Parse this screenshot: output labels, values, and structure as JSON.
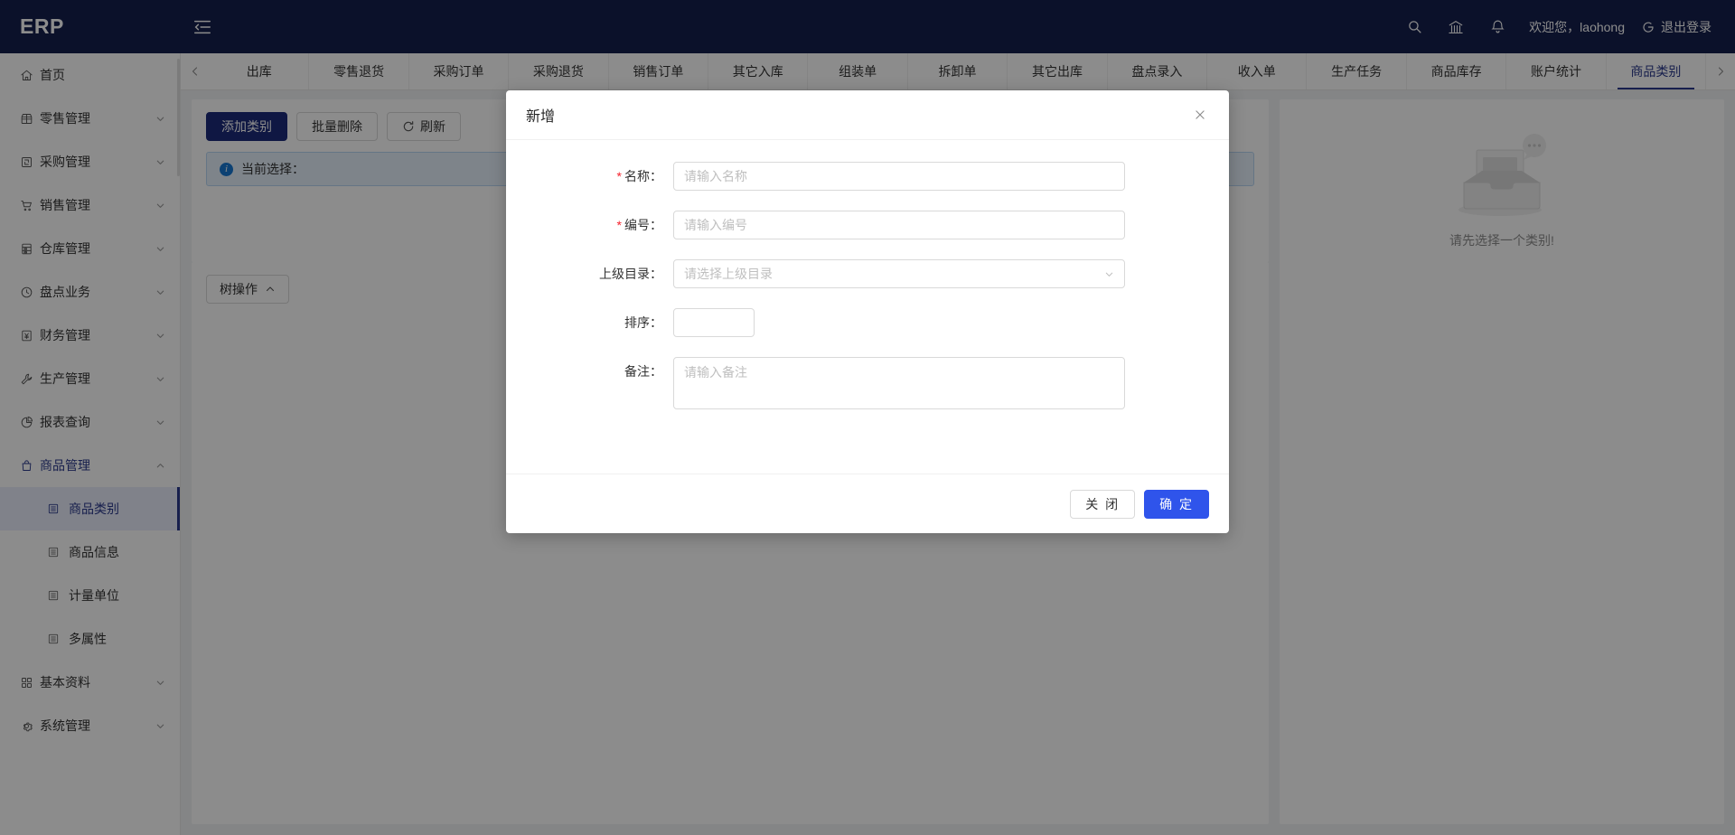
{
  "header": {
    "logo": "ERP",
    "collapse_icon": "menu-fold-icon",
    "search_icon": "search-icon",
    "bank_icon": "bank-icon",
    "bell_icon": "bell-icon",
    "welcome": "欢迎您，laohong",
    "logout_label": "退出登录",
    "logout_icon": "logout-icon",
    "bg_color": "#141f4d"
  },
  "sidebar": {
    "items": [
      {
        "label": "首页",
        "icon": "home-icon",
        "arrow": "",
        "open": false
      },
      {
        "label": "零售管理",
        "icon": "shop-icon",
        "arrow": "▾",
        "open": false
      },
      {
        "label": "采购管理",
        "icon": "sync-icon",
        "arrow": "▾",
        "open": false
      },
      {
        "label": "销售管理",
        "icon": "cart-icon",
        "arrow": "▾",
        "open": false
      },
      {
        "label": "仓库管理",
        "icon": "database-icon",
        "arrow": "▾",
        "open": false
      },
      {
        "label": "盘点业务",
        "icon": "clock-icon",
        "arrow": "▾",
        "open": false
      },
      {
        "label": "财务管理",
        "icon": "money-icon",
        "arrow": "▾",
        "open": false
      },
      {
        "label": "生产管理",
        "icon": "tool-icon",
        "arrow": "▾",
        "open": false
      },
      {
        "label": "报表查询",
        "icon": "pie-chart-icon",
        "arrow": "▾",
        "open": false
      },
      {
        "label": "商品管理",
        "icon": "bag-icon",
        "arrow": "▴",
        "open": true
      }
    ],
    "submenu": [
      {
        "label": "商品类别",
        "icon": "list-icon",
        "active": true
      },
      {
        "label": "商品信息",
        "icon": "list-icon",
        "active": false
      },
      {
        "label": "计量单位",
        "icon": "list-icon",
        "active": false
      },
      {
        "label": "多属性",
        "icon": "list-icon",
        "active": false
      }
    ],
    "items_after": [
      {
        "label": "基本资料",
        "icon": "appstore-icon",
        "arrow": "▾",
        "open": false
      },
      {
        "label": "系统管理",
        "icon": "gear-icon",
        "arrow": "▾",
        "open": false
      }
    ],
    "active_color": "#2b3a8c"
  },
  "tabbar": {
    "prev_icon": "chevron-left-icon",
    "next_icon": "chevron-right-icon",
    "tabs": [
      {
        "label": "出库",
        "active": false
      },
      {
        "label": "零售退货",
        "active": false
      },
      {
        "label": "采购订单",
        "active": false
      },
      {
        "label": "采购退货",
        "active": false
      },
      {
        "label": "销售订单",
        "active": false
      },
      {
        "label": "其它入库",
        "active": false
      },
      {
        "label": "组装单",
        "active": false
      },
      {
        "label": "拆卸单",
        "active": false
      },
      {
        "label": "其它出库",
        "active": false
      },
      {
        "label": "盘点录入",
        "active": false
      },
      {
        "label": "收入单",
        "active": false
      },
      {
        "label": "生产任务",
        "active": false
      },
      {
        "label": "商品库存",
        "active": false
      },
      {
        "label": "账户统计",
        "active": false
      },
      {
        "label": "商品类别",
        "active": true
      }
    ]
  },
  "toolbar": {
    "add_category_label": "添加类别",
    "batch_delete_label": "批量删除",
    "refresh_label": "刷新",
    "refresh_icon": "reload-icon"
  },
  "alert": {
    "icon": "info-circle-icon",
    "text": "当前选择："
  },
  "tree_panel": {
    "op_label": "树操作",
    "op_arrow": "︿"
  },
  "right_panel": {
    "empty_icon": "empty-inbox-icon",
    "empty_text": "请先选择一个类别!"
  },
  "modal": {
    "title": "新增",
    "close_icon": "close-icon",
    "fields": [
      {
        "label": "名称：",
        "required": true,
        "type": "input",
        "value": "",
        "placeholder": "请输入名称"
      },
      {
        "label": "编号：",
        "required": true,
        "type": "input",
        "value": "",
        "placeholder": "请输入编号"
      },
      {
        "label": "上级目录：",
        "required": false,
        "type": "select",
        "value": "",
        "placeholder": "请选择上级目录",
        "arrow_icon": "chevron-down-icon"
      },
      {
        "label": "排序：",
        "required": false,
        "type": "number",
        "value": "",
        "placeholder": ""
      },
      {
        "label": "备注：",
        "required": false,
        "type": "textarea",
        "value": "",
        "placeholder": "请输入备注"
      }
    ],
    "close_label": "关 闭",
    "confirm_label": "确 定",
    "confirm_color": "#2f54eb"
  }
}
